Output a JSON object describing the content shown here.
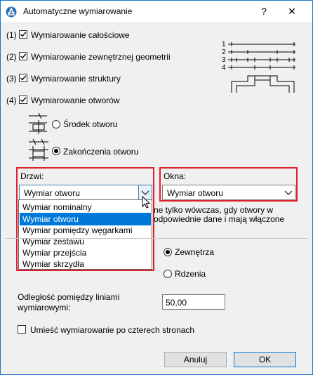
{
  "window": {
    "title": "Automatyczne wymiarowanie",
    "help_symbol": "?",
    "close_symbol": "✕"
  },
  "options": {
    "overall": {
      "number": "(1)",
      "label": "Wymiarowanie całościowe",
      "checked": true
    },
    "exterior": {
      "number": "(2)",
      "label": "Wymiarowanie zewnętrznej geometrii",
      "checked": true
    },
    "structure": {
      "number": "(3)",
      "label": "Wymiarowanie struktury",
      "checked": true
    },
    "openings": {
      "number": "(4)",
      "label": "Wymiarowanie otworów",
      "checked": true
    }
  },
  "preview_diagram": {
    "line_labels": [
      "1",
      "2",
      "3",
      "4"
    ]
  },
  "opening_mode": {
    "center_label": "Środek otworu",
    "ends_label": "Zakończenia otworu",
    "selected": "ends"
  },
  "doors": {
    "label": "Drzwi:",
    "selected": "Wymiar otworu",
    "options": [
      "Wymiar nominalny",
      "Wymiar otworu",
      "Wymiar pomiędzy węgarkami",
      "Wymiar zestawu",
      "Wymiar przejścia",
      "Wymiar skrzydła"
    ],
    "highlighted_index": 1
  },
  "windows": {
    "label": "Okna:",
    "selected": "Wymiar otworu"
  },
  "note": {
    "line1": "ne tylko wówczas, gdy otwory w",
    "line2": "odpowiednie dane i mają włączone"
  },
  "reference": {
    "exterior_label": "Zewnętrza",
    "core_label": "Rdzenia",
    "selected": "exterior"
  },
  "distance": {
    "label_line1": "Odległość pomiędzy liniami",
    "label_line2": "wymiarowymi:",
    "value": "50,00"
  },
  "four_sides": {
    "label": "Umieść wymiarowanie po czterech stronach",
    "checked": false
  },
  "buttons": {
    "cancel": "Anuluj",
    "ok": "OK"
  },
  "colors": {
    "highlight_frame": "#e0212b",
    "selection": "#0078d7"
  }
}
